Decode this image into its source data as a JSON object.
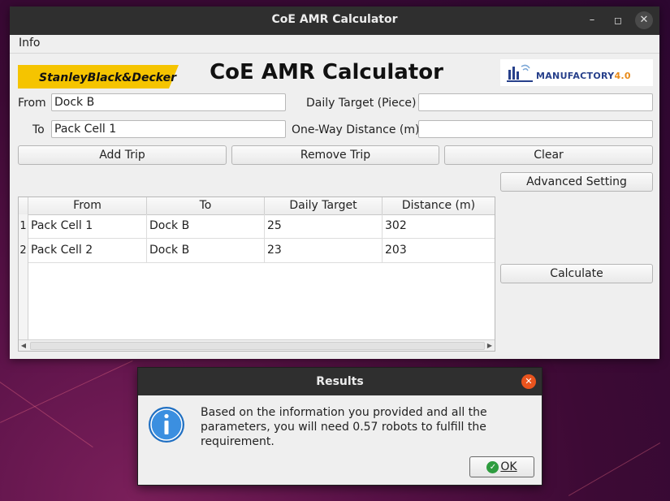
{
  "window": {
    "title": "CoE AMR Calculator"
  },
  "menu": {
    "info": "Info"
  },
  "header": {
    "sbd_logo_text": "StanleyBlack&Decker",
    "heading": "CoE AMR Calculator",
    "mf_logo_text": "MANUFACTORY",
    "mf_logo_version": "4.0"
  },
  "form": {
    "from_label": "From",
    "from_value": "Dock B",
    "to_label": "To",
    "to_value": "Pack Cell 1",
    "daily_target_label": "Daily Target (Piece)",
    "daily_target_value": "",
    "distance_label": "One-Way Distance (m)",
    "distance_value": ""
  },
  "buttons": {
    "add_trip": "Add Trip",
    "remove_trip": "Remove Trip",
    "clear": "Clear",
    "advanced": "Advanced Setting",
    "calculate": "Calculate"
  },
  "table": {
    "columns": [
      "From",
      "To",
      "Daily Target",
      "Distance (m)"
    ],
    "rows": [
      {
        "index": "1",
        "from": "Pack Cell 1",
        "to": "Dock B",
        "target": "25",
        "distance": "302"
      },
      {
        "index": "2",
        "from": "Pack Cell 2",
        "to": "Dock B",
        "target": "23",
        "distance": "203"
      }
    ]
  },
  "dialog": {
    "title": "Results",
    "message": "Based on the information you provided and all the parameters, you will need 0.57 robots to fulfill the requirement.",
    "ok_label": "OK"
  },
  "colors": {
    "sbd_yellow": "#f5c400",
    "ok_green": "#2e9c3f",
    "close_orange": "#e9541e",
    "info_blue": "#2a7fd0"
  }
}
